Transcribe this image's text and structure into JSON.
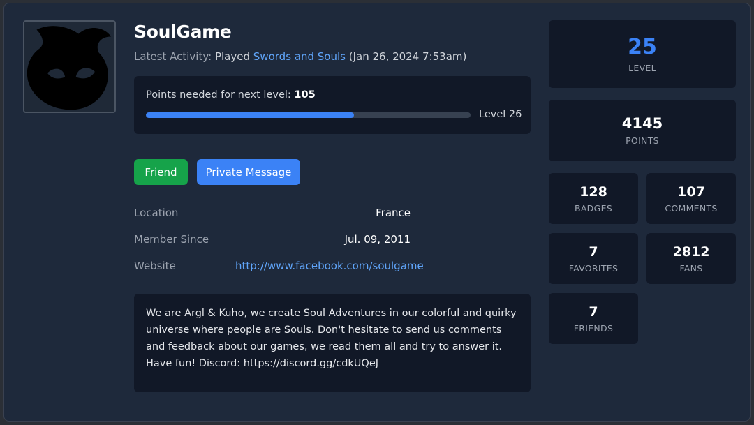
{
  "profile": {
    "username": "SoulGame",
    "activity_prefix": "Latest Activity:",
    "activity_action": "Played",
    "activity_game": "Swords and Souls",
    "activity_time": "(Jan 26, 2024 7:53am)",
    "avatar_icon": "flame-mask-logo"
  },
  "progress": {
    "label": "Points needed for next level:",
    "points_needed": "105",
    "fill_percent": 64,
    "next_level": "Level 26"
  },
  "actions": {
    "friend_label": "Friend",
    "message_label": "Private Message"
  },
  "info": {
    "location_label": "Location",
    "location_value": "France",
    "member_label": "Member Since",
    "member_value": "Jul. 09, 2011",
    "website_label": "Website",
    "website_value": "http://www.facebook.com/soulgame"
  },
  "bio": {
    "text": "We are Argl & Kuho, we create Soul Adventures in our colorful and quirky universe where people are Souls. Don't hesitate to send us comments and feedback about our games, we read them all and try to answer it. Have fun! Discord: https://discord.gg/cdkUQeJ"
  },
  "stats": {
    "level": {
      "value": "25",
      "label": "LEVEL"
    },
    "points": {
      "value": "4145",
      "label": "POINTS"
    },
    "badges": {
      "value": "128",
      "label": "BADGES"
    },
    "comments": {
      "value": "107",
      "label": "COMMENTS"
    },
    "favorites": {
      "value": "7",
      "label": "FAVORITES"
    },
    "fans": {
      "value": "2812",
      "label": "FANS"
    },
    "friends": {
      "value": "7",
      "label": "FRIENDS"
    }
  },
  "colors": {
    "background": "#1e293b",
    "card": "#111827",
    "accent": "#3b82f6",
    "link": "#60a5fa",
    "friend_button": "#16a34a"
  }
}
